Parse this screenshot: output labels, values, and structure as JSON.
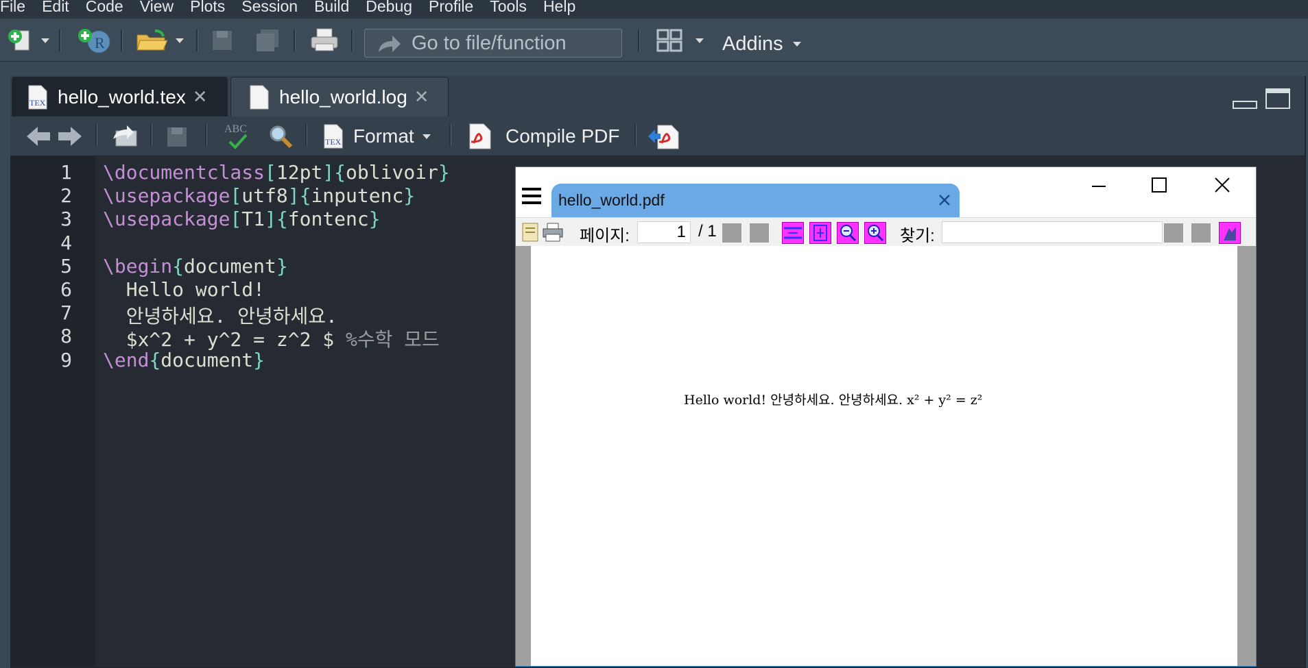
{
  "menu": [
    "File",
    "Edit",
    "Code",
    "View",
    "Plots",
    "Session",
    "Build",
    "Debug",
    "Profile",
    "Tools",
    "Help"
  ],
  "toolbar": {
    "goto_placeholder": "Go to file/function",
    "addins_label": "Addins"
  },
  "tabs": [
    {
      "label": "hello_world.tex",
      "active": true
    },
    {
      "label": "hello_world.log",
      "active": false
    }
  ],
  "editor_toolbar": {
    "format_label": "Format",
    "compile_label": "Compile PDF"
  },
  "editor": {
    "line_numbers": [
      "1",
      "2",
      "3",
      "4",
      "5",
      "6",
      "7",
      "8",
      "9"
    ],
    "lines": [
      {
        "parts": [
          [
            "kw",
            "\\documentclass"
          ],
          [
            "br",
            "["
          ],
          [
            "arg",
            "12pt"
          ],
          [
            "br",
            "]"
          ],
          [
            "br",
            "{"
          ],
          [
            "arg",
            "oblivoir"
          ],
          [
            "br",
            "}"
          ]
        ]
      },
      {
        "parts": [
          [
            "kw",
            "\\usepackage"
          ],
          [
            "br",
            "["
          ],
          [
            "arg",
            "utf8"
          ],
          [
            "br",
            "]"
          ],
          [
            "br",
            "{"
          ],
          [
            "arg",
            "inputenc"
          ],
          [
            "br",
            "}"
          ]
        ]
      },
      {
        "parts": [
          [
            "kw",
            "\\usepackage"
          ],
          [
            "br",
            "["
          ],
          [
            "arg",
            "T1"
          ],
          [
            "br",
            "]"
          ],
          [
            "br",
            "{"
          ],
          [
            "arg",
            "fontenc"
          ],
          [
            "br",
            "}"
          ]
        ]
      },
      {
        "parts": []
      },
      {
        "parts": [
          [
            "kw",
            "\\begin"
          ],
          [
            "br",
            "{"
          ],
          [
            "arg",
            "document"
          ],
          [
            "br",
            "}"
          ]
        ]
      },
      {
        "parts": [
          [
            "arg",
            "  Hello world!"
          ]
        ]
      },
      {
        "parts": [
          [
            "arg",
            "  안녕하세요. 안녕하세요."
          ]
        ]
      },
      {
        "parts": [
          [
            "arg",
            "  $x^2 + y^2 = z^2 $ "
          ],
          [
            "cm",
            "%수학 모드"
          ]
        ]
      },
      {
        "parts": [
          [
            "kw",
            "\\end"
          ],
          [
            "br",
            "{"
          ],
          [
            "arg",
            "document"
          ],
          [
            "br",
            "}"
          ]
        ]
      }
    ]
  },
  "pdf_viewer": {
    "tab_title": "hello_world.pdf",
    "page_label": "페이지:",
    "page_current": "1",
    "page_total": "/ 1",
    "find_label": "찾기:",
    "content": "Hello world! 안녕하세요. 안녕하세요. x² + y² = z²"
  }
}
